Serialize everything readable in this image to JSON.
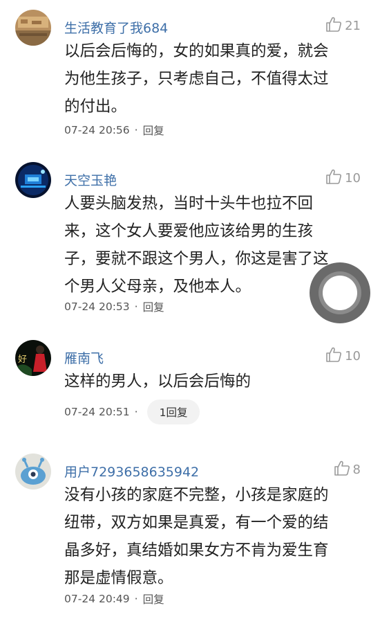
{
  "colors": {
    "username": "#3e6fa8",
    "text": "#222222",
    "meta": "#555555",
    "likes": "#9a9a9a"
  },
  "comments": [
    {
      "username": "生活教育了我684",
      "likes": "21",
      "lines": [
        "以后会后悔的，女的如果真的爱，就会",
        "为他生孩子，只考虑自己，不值得太过",
        "的付出。"
      ],
      "time": "07-24 20:56",
      "separator": "·",
      "reply": "回复"
    },
    {
      "username": "天空玉艳",
      "likes": "10",
      "lines": [
        "人要头脑发热，当时十头牛也拉不回",
        "来，这个女人要爱他应该给男的生孩",
        "子，要就不跟这个男人，你这是害了这",
        "个男人父母亲，及他本人。"
      ],
      "time": "07-24 20:53",
      "separator": "·",
      "reply": "回复"
    },
    {
      "username": "雁南飞",
      "likes": "10",
      "avatar_text": "好",
      "lines": [
        "这样的男人，以后会后悔的"
      ],
      "time": "07-24 20:51",
      "separator": "·",
      "reply": "1回复"
    },
    {
      "username": "用户7293658635942",
      "likes": "8",
      "lines": [
        "没有小孩的家庭不完整，小孩是家庭的",
        "纽带，双方如果是真爱，有一个爱的结",
        "晶多好，真结婚如果女方不肯为爱生育",
        "那是虚情假意。"
      ],
      "time": "07-24 20:49",
      "separator": "·",
      "reply": "回复"
    }
  ],
  "icons": {
    "like": "thumbs-up-icon",
    "floating": "floating-circle-button"
  }
}
